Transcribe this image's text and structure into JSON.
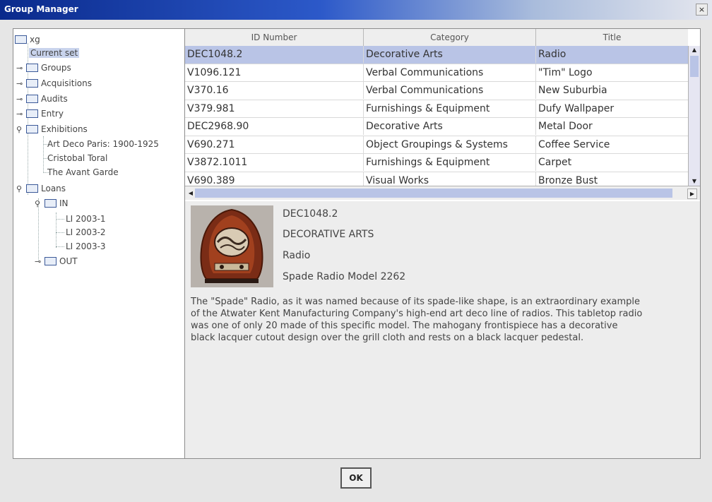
{
  "window": {
    "title": "Group Manager",
    "close_label": "×"
  },
  "tree": {
    "root": "xg",
    "current_set": "Current set",
    "groups": "Groups",
    "acquisitions": "Acquisitions",
    "audits": "Audits",
    "entry": "Entry",
    "exhibitions": "Exhibitions",
    "exhibition_items": [
      "Art Deco Paris: 1900-1925",
      "Cristobal Toral",
      "The Avant Garde"
    ],
    "loans": "Loans",
    "in": "IN",
    "in_items": [
      "LI 2003-1",
      "LI 2003-2",
      "LI 2003-3"
    ],
    "out": "OUT"
  },
  "table": {
    "columns": [
      "ID Number",
      "Category",
      "Title"
    ],
    "rows": [
      [
        "DEC1048.2",
        "Decorative Arts",
        "Radio"
      ],
      [
        "V1096.121",
        "Verbal Communications",
        "\"Tim\" Logo"
      ],
      [
        "V370.16",
        "Verbal Communications",
        "New Suburbia"
      ],
      [
        "V379.981",
        "Furnishings & Equipment",
        "Dufy Wallpaper"
      ],
      [
        "DEC2968.90",
        "Decorative Arts",
        "Metal Door"
      ],
      [
        "V690.271",
        "Object Groupings & Systems",
        "Coffee Service"
      ],
      [
        "V3872.1011",
        "Furnishings & Equipment",
        "Carpet"
      ],
      [
        "V690.389",
        "Visual Works",
        "Bronze Bust"
      ]
    ]
  },
  "detail": {
    "id": "DEC1048.2",
    "category": "DECORATIVE ARTS",
    "title": "Radio",
    "object_name": "Spade Radio Model 2262",
    "description": "The \"Spade\" Radio, as it was named because of its spade-like shape, is an extraordinary example of the Atwater Kent Manufacturing Company's high-end art deco line of radios.  This tabletop radio was one of only 20 made of this specific model.  The mahogany frontispiece has a decorative black lacquer cutout design over the grill cloth and rests on a black lacquer pedestal."
  },
  "buttons": {
    "ok": "OK"
  }
}
